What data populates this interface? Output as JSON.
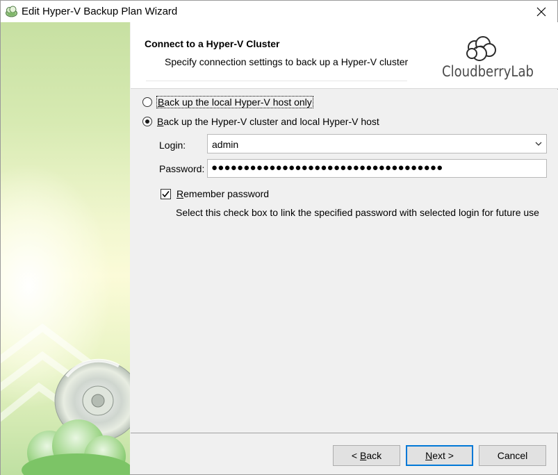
{
  "window": {
    "title": "Edit Hyper-V Backup Plan Wizard"
  },
  "header": {
    "title": "Connect to a Hyper-V Cluster",
    "subtitle": "Specify connection settings to back up a Hyper-V cluster",
    "logo_text": "CloudberryLab"
  },
  "options": {
    "local_only": {
      "prefix": "B",
      "rest": "ack up the local Hyper-V host only",
      "selected": false
    },
    "cluster_and_local": {
      "prefix": "B",
      "rest": "ack up the Hyper-V cluster and local Hyper-V host",
      "selected": true
    }
  },
  "form": {
    "login_label": "Login:",
    "login_value": "admin",
    "password_label": "Password:",
    "password_mask": "●●●●●●●●●●●●●●●●●●●●●●●●●●●●●●●●●●●●",
    "remember": {
      "prefix": "R",
      "rest": "emember password",
      "checked": true
    },
    "remember_hint": "Select this check box to link the specified password with selected login for future use"
  },
  "buttons": {
    "back": {
      "pre": "< ",
      "key": "B",
      "post": "ack"
    },
    "next": {
      "pre": "",
      "key": "N",
      "post": "ext >"
    },
    "cancel": "Cancel"
  },
  "icons": {
    "app": "cloud-backup-icon",
    "close": "close-icon",
    "dropdown": "chevron-down-icon",
    "check": "checkmark-icon",
    "logo": "cloudberry-logo"
  }
}
